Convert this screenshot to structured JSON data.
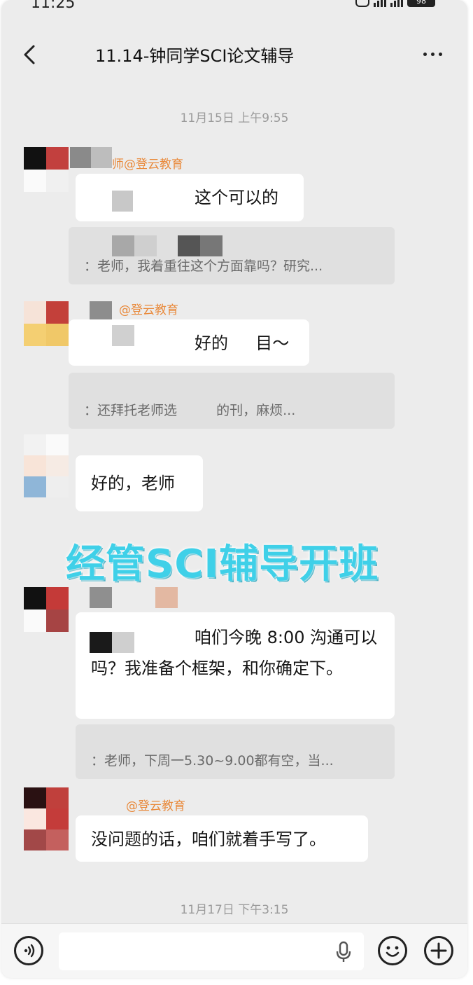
{
  "status": {
    "time": "11:25",
    "battery": "98"
  },
  "header": {
    "title": "11.14-钟同学SCI论文辅导"
  },
  "timestamps": {
    "first": "11月15日 上午9:55",
    "second": "11月17日 下午3:15"
  },
  "messages": [
    {
      "sender": "师@登云教育",
      "text": "这个可以的"
    },
    {
      "quote": "：老师，我着重往这个方面靠吗？研究..."
    },
    {
      "sender": "@登云教育",
      "text": "好的 　 目～"
    },
    {
      "quote": "：还拜托老师选 　 　 的刊，麻烦..."
    },
    {
      "text": "好的，老师"
    },
    {
      "text": "咱们今晚 8:00 沟通可以吗？我准备个框架，和你确定下。"
    },
    {
      "quote": "：老师，下周一5.30~9.00都有空，当..."
    },
    {
      "sender": "@登云教育",
      "text": "没问题的话，咱们就着手写了。"
    }
  ],
  "overlay": {
    "banner": "经管SCI辅导开班"
  },
  "icons": {
    "back": "chevron-left-icon",
    "more": "more-dots-icon",
    "voice": "voice-icon",
    "mic": "microphone-icon",
    "emoji": "emoji-icon",
    "add": "add-icon"
  },
  "colors": {
    "sender": "#e9893a",
    "banner": "#3fd0e8",
    "background": "#ececec"
  },
  "input": {
    "placeholder": ""
  }
}
